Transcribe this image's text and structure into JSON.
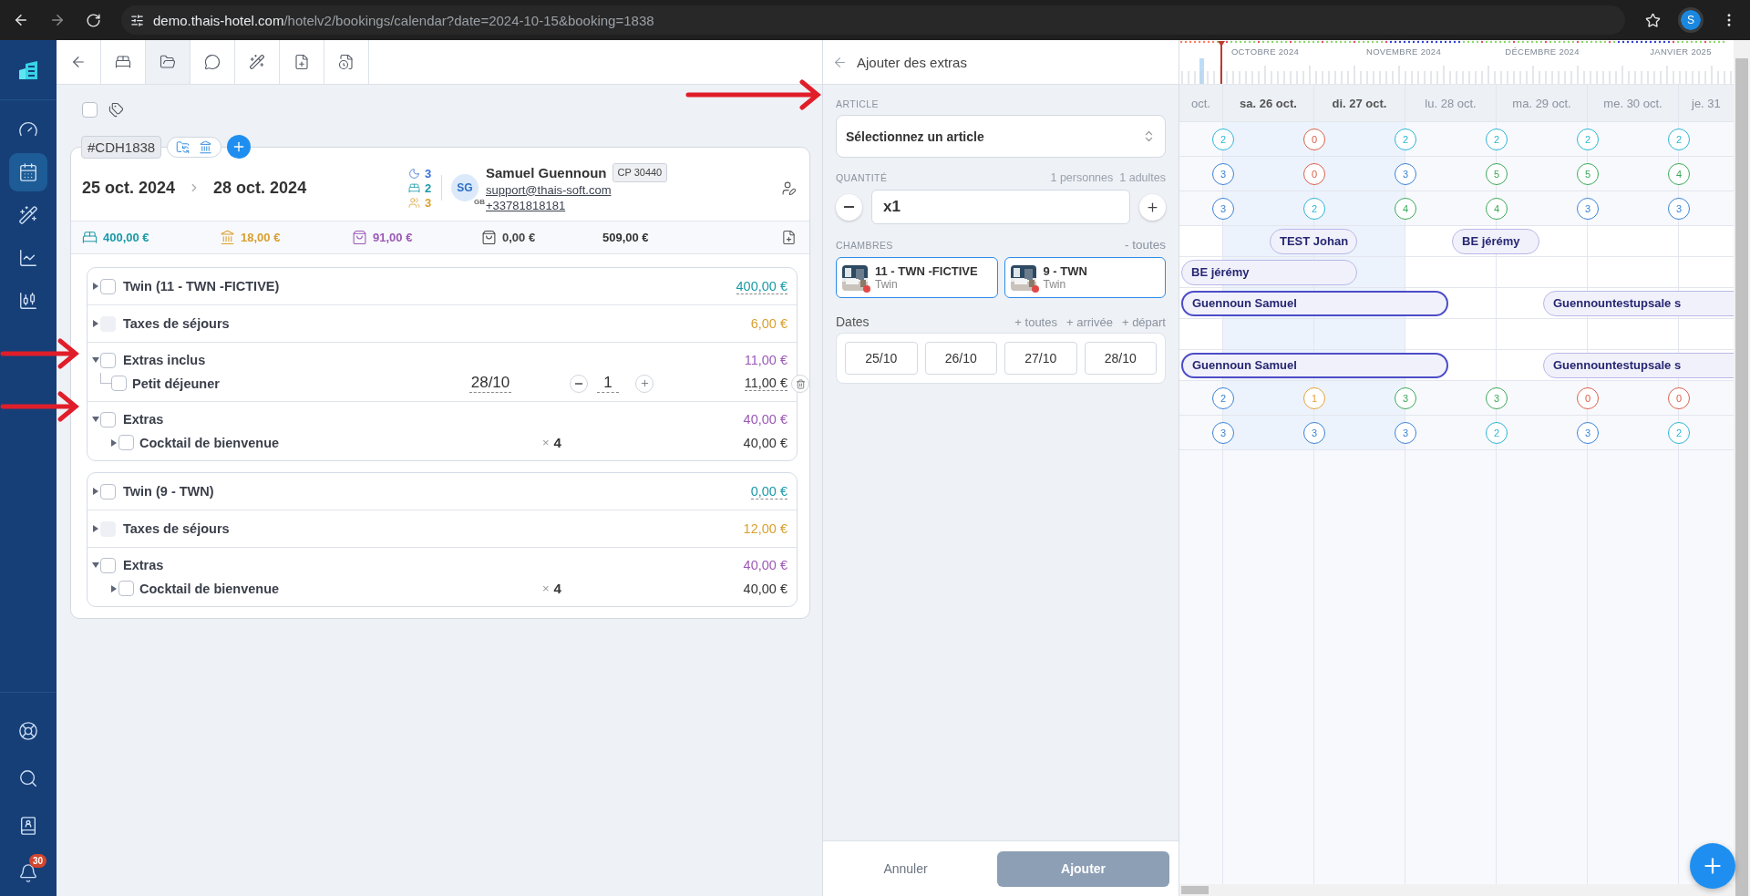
{
  "browser": {
    "url_host": "demo.thais-hotel.com",
    "url_path": "/hotelv2/bookings/calendar?date=2024-10-15&booking=1838",
    "profile_initial": "S"
  },
  "sidebar": {
    "items": [
      {
        "kind": "dashboard",
        "selected": false
      },
      {
        "kind": "calendar",
        "selected": true
      },
      {
        "kind": "wand",
        "selected": false
      },
      {
        "kind": "chart",
        "selected": false
      },
      {
        "kind": "candles",
        "selected": false
      }
    ],
    "bottom_items": [
      {
        "kind": "help",
        "selected": false
      },
      {
        "kind": "search",
        "selected": false
      },
      {
        "kind": "contacts",
        "selected": false
      },
      {
        "kind": "notifications",
        "selected": false,
        "badge": "30"
      }
    ]
  },
  "booking_tabs": [
    {
      "kind": "bed",
      "selected": false
    },
    {
      "kind": "folder",
      "selected": true
    },
    {
      "kind": "chat",
      "selected": false
    },
    {
      "kind": "wand",
      "selected": false
    },
    {
      "kind": "file-plus",
      "selected": false
    },
    {
      "kind": "file-clock",
      "selected": false
    }
  ],
  "select_all": {
    "checked": false
  },
  "booking": {
    "reference": "#CDH1838",
    "arrival": "25 oct. 2024",
    "departure": "28 oct. 2024",
    "nights": "3",
    "rooms": "2",
    "guests": "3",
    "guest": {
      "initials": "SG",
      "country": "GB",
      "name": "Samuel Guennoun",
      "code": "CP 30440",
      "email": "support@thais-soft.com",
      "phone": "+33781818181"
    },
    "totals": [
      {
        "kind": "rooms",
        "amount": "400,00 €"
      },
      {
        "kind": "taxes",
        "amount": "18,00 €"
      },
      {
        "kind": "extras",
        "amount": "91,00 €"
      },
      {
        "kind": "paid",
        "amount": "0,00 €"
      },
      {
        "kind": "total",
        "amount": "509,00 €"
      }
    ]
  },
  "rooms": [
    {
      "label": "Twin (11 - TWN -FICTIVE)",
      "amount": "400,00 €",
      "expanded": false,
      "checked": false,
      "sections": [
        {
          "kind": "tax",
          "label": "Taxes de séjours",
          "amount": "6,00 €",
          "expanded": false,
          "checked": false,
          "disabled": true
        },
        {
          "kind": "extras",
          "label": "Extras inclus",
          "amount": "11,00 €",
          "expanded": true,
          "checked": false,
          "disabled": false,
          "children": [
            {
              "kind": "editable",
              "label": "Petit déjeuner",
              "checked": false,
              "date": "28/10",
              "quantity": "1",
              "amount": "11,00 €"
            }
          ]
        },
        {
          "kind": "extras",
          "label": "Extras",
          "amount": "40,00 €",
          "expanded": true,
          "checked": false,
          "disabled": false,
          "children": [
            {
              "kind": "counted",
              "label": "Cocktail de bienvenue",
              "checked": false,
              "expanded": false,
              "times": "×",
              "count": "4",
              "amount": "40,00 €"
            }
          ]
        }
      ]
    },
    {
      "label": "Twin (9 - TWN)",
      "amount": "0,00 €",
      "expanded": false,
      "checked": false,
      "sections": [
        {
          "kind": "tax",
          "label": "Taxes de séjours",
          "amount": "12,00 €",
          "expanded": false,
          "checked": false,
          "disabled": true
        },
        {
          "kind": "extras",
          "label": "Extras",
          "amount": "40,00 €",
          "expanded": true,
          "checked": false,
          "disabled": false,
          "children": [
            {
              "kind": "counted",
              "label": "Cocktail de bienvenue",
              "checked": false,
              "expanded": false,
              "times": "×",
              "count": "4",
              "amount": "40,00 €"
            }
          ]
        }
      ]
    }
  ],
  "extras_panel": {
    "title": "Ajouter des extras",
    "article_label": "ARTICLE",
    "article_select": "Sélectionnez un article",
    "quantity_label": "QUANTITÉ",
    "persons": "1 personnes",
    "adults": "1 adultes",
    "quantity_value": "x1",
    "rooms_label": "CHAMBRES",
    "rooms_toggle": "- toutes",
    "rooms": [
      {
        "name": "11 - TWN -FICTIVE",
        "type": "Twin",
        "selected": true
      },
      {
        "name": "9 - TWN",
        "type": "Twin",
        "selected": true
      }
    ],
    "dates_label": "Dates",
    "date_links": [
      "+ toutes",
      "+ arrivée",
      "+ départ"
    ],
    "dates": [
      {
        "label": "25/10",
        "selected": false
      },
      {
        "label": "26/10",
        "selected": false
      },
      {
        "label": "27/10",
        "selected": false
      },
      {
        "label": "28/10",
        "selected": false
      }
    ],
    "cancel": "Annuler",
    "submit": {
      "label": "Ajouter",
      "disabled": true
    }
  },
  "calendar": {
    "months": [
      "OCTOBRE 2024",
      "NOVEMBRE 2024",
      "DÉCEMBRE 2024",
      "JANVIER 2025"
    ],
    "days": [
      {
        "label": "oct.",
        "weekend": false
      },
      {
        "label": "sa. 26 oct.",
        "weekend": true
      },
      {
        "label": "di. 27 oct.",
        "weekend": true
      },
      {
        "label": "lu. 28 oct.",
        "weekend": false
      },
      {
        "label": "ma. 29 oct.",
        "weekend": false
      },
      {
        "label": "me. 30 oct.",
        "weekend": false
      },
      {
        "label": "je. 31",
        "weekend": false
      }
    ],
    "rows": [
      {
        "kind": "counts",
        "counts": [
          {
            "value": "2",
            "color": "#2bb5d6"
          },
          {
            "value": "0",
            "color": "#d9604c"
          },
          {
            "value": "2",
            "color": "#2bb5d6"
          },
          {
            "value": "2",
            "color": "#2bb5d6"
          },
          {
            "value": "2",
            "color": "#2bb5d6"
          },
          {
            "value": "2",
            "color": "#2bb5d6"
          }
        ]
      },
      {
        "kind": "counts",
        "counts": [
          {
            "value": "3",
            "color": "#3b82d6"
          },
          {
            "value": "0",
            "color": "#d9604c"
          },
          {
            "value": "3",
            "color": "#3b82d6"
          },
          {
            "value": "5",
            "color": "#3aa95a"
          },
          {
            "value": "5",
            "color": "#3aa95a"
          },
          {
            "value": "4",
            "color": "#3aa95a"
          }
        ]
      },
      {
        "kind": "counts",
        "counts": [
          {
            "value": "3",
            "color": "#3b82d6"
          },
          {
            "value": "2",
            "color": "#2bb5d6"
          },
          {
            "value": "4",
            "color": "#3aa95a"
          },
          {
            "value": "4",
            "color": "#3aa95a"
          },
          {
            "value": "3",
            "color": "#3b82d6"
          },
          {
            "value": "3",
            "color": "#3b82d6"
          }
        ]
      },
      {
        "kind": "bookings",
        "bookings": [
          {
            "label": "TEST Johan",
            "selected": false
          },
          {
            "label": "BE jérémy",
            "selected": false
          }
        ]
      },
      {
        "kind": "bookings",
        "bookings": [
          {
            "label": "BE jérémy",
            "selected": false
          }
        ]
      },
      {
        "kind": "bookings",
        "bookings": [
          {
            "label": "Guennoun Samuel",
            "selected": true
          },
          {
            "label": "Guennountestupsale s",
            "selected": false
          }
        ]
      },
      {
        "kind": "empty"
      },
      {
        "kind": "bookings",
        "bookings": [
          {
            "label": "Guennoun Samuel",
            "selected": true
          },
          {
            "label": "Guennountestupsale s",
            "selected": false
          }
        ]
      },
      {
        "kind": "counts",
        "counts": [
          {
            "value": "2",
            "color": "#3b82d6"
          },
          {
            "value": "1",
            "color": "#e6a23c"
          },
          {
            "value": "3",
            "color": "#3aa95a"
          },
          {
            "value": "3",
            "color": "#3aa95a"
          },
          {
            "value": "0",
            "color": "#d9604c"
          },
          {
            "value": "0",
            "color": "#d9604c"
          }
        ]
      },
      {
        "kind": "counts",
        "counts": [
          {
            "value": "3",
            "color": "#3b82d6"
          },
          {
            "value": "3",
            "color": "#3b82d6"
          },
          {
            "value": "3",
            "color": "#3b82d6"
          },
          {
            "value": "2",
            "color": "#2bb5d6"
          },
          {
            "value": "3",
            "color": "#3b82d6"
          },
          {
            "value": "2",
            "color": "#2bb5d6"
          }
        ]
      }
    ]
  }
}
